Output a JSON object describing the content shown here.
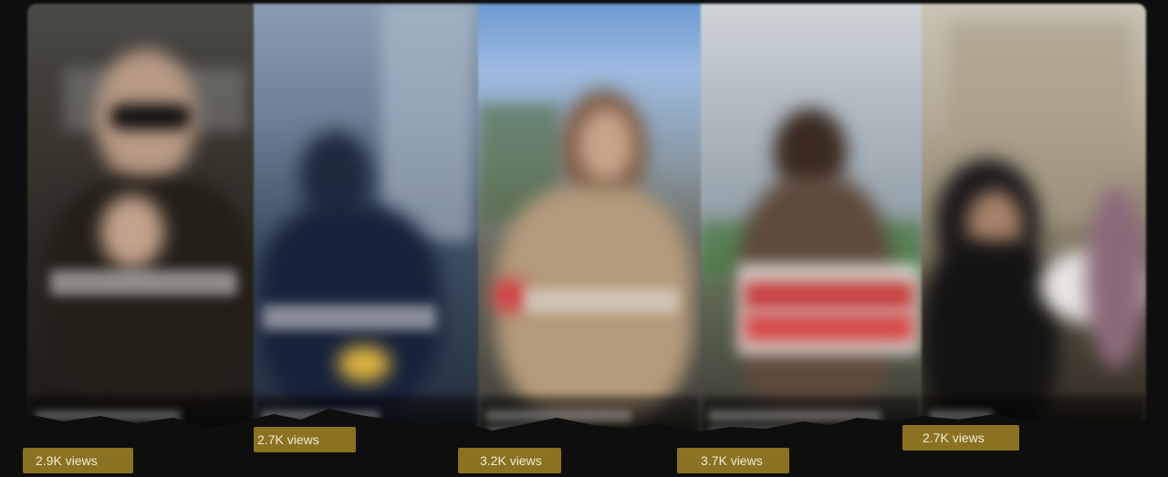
{
  "thumbnails": [
    {
      "name": "thumbnail-1",
      "views": "2.9K views"
    },
    {
      "name": "thumbnail-2",
      "views": "2.7K views"
    },
    {
      "name": "thumbnail-3",
      "views": "3.2K views"
    },
    {
      "name": "thumbnail-4",
      "views": "3.7K views"
    },
    {
      "name": "thumbnail-5",
      "views": "2.7K views"
    }
  ],
  "colors": {
    "background": "#0e0e0e",
    "label_fill": "#8a7222",
    "label_text": "#f1ebd6"
  }
}
